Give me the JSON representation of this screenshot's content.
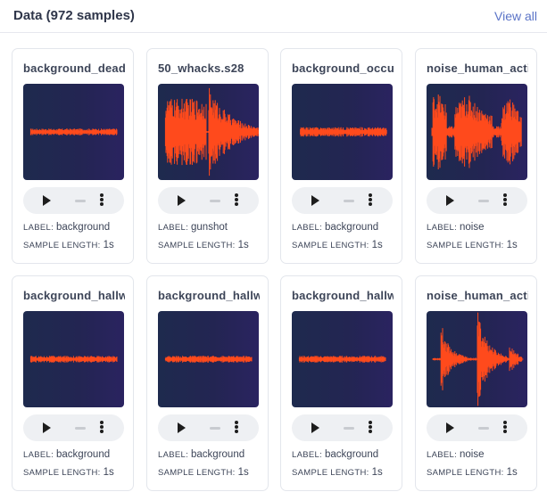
{
  "header": {
    "title": "Data (972 samples)",
    "view_all": "View all"
  },
  "labels": {
    "label_key": "LABEL:",
    "length_key": "SAMPLE LENGTH:"
  },
  "colors": {
    "waveform": "#ff4a1c",
    "panel_left": "#1e2a4e",
    "panel_right": "#2a2360",
    "link": "#5b74c7"
  },
  "samples": [
    {
      "name": "background_dead_",
      "label": "background",
      "length": "1s",
      "wave": "flat"
    },
    {
      "name": "50_whacks.s28",
      "label": "gunshot",
      "length": "1s",
      "wave": "gunshot"
    },
    {
      "name": "background_occup",
      "label": "background",
      "length": "1s",
      "wave": "flat2"
    },
    {
      "name": "noise_human_acti",
      "label": "noise",
      "length": "1s",
      "wave": "noise_a"
    },
    {
      "name": "background_hallw",
      "label": "background",
      "length": "1s",
      "wave": "flat3"
    },
    {
      "name": "background_hallw",
      "label": "background",
      "length": "1s",
      "wave": "flat4"
    },
    {
      "name": "background_hallw",
      "label": "background",
      "length": "1s",
      "wave": "flat5"
    },
    {
      "name": "noise_human_acti",
      "label": "noise",
      "length": "1s",
      "wave": "noise_b"
    }
  ]
}
